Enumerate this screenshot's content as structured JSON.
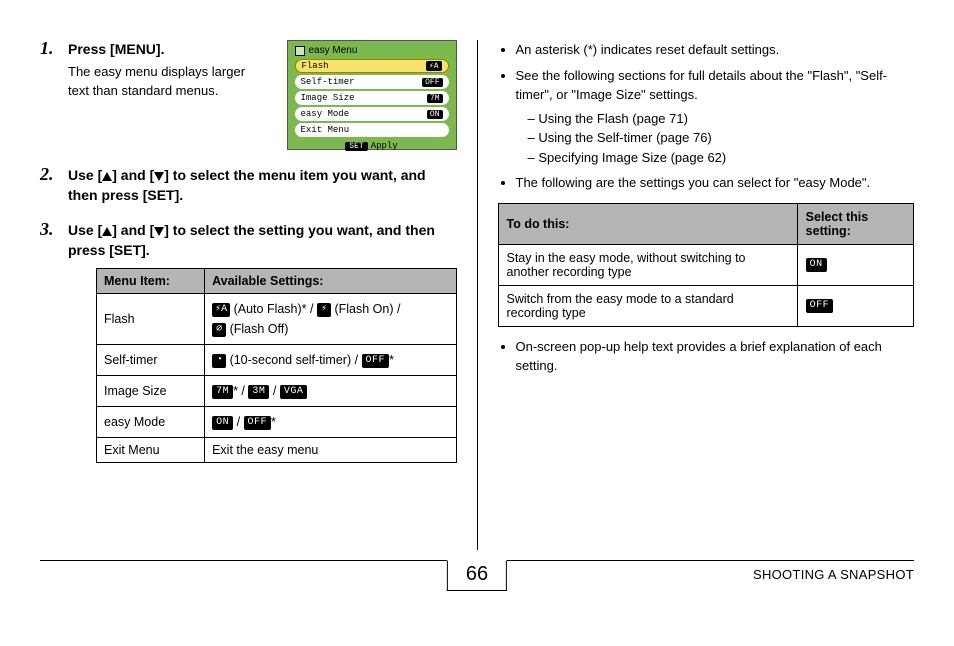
{
  "steps": [
    {
      "num": "1.",
      "head": "Press [MENU].",
      "body": "The easy menu displays larger text than standard menus."
    },
    {
      "num": "2.",
      "head_pre": "Use [",
      "head_mid": "] and [",
      "head_post": "] to select the menu item you want, and then press [SET]."
    },
    {
      "num": "3.",
      "head_pre": "Use [",
      "head_mid": "] and [",
      "head_post": "] to select the setting you want, and then press [SET]."
    }
  ],
  "easyMenu": {
    "title": "easy Menu",
    "rows": [
      {
        "label": "Flash",
        "badge": "⚡A",
        "selected": true
      },
      {
        "label": "Self-timer",
        "badge": "OFF"
      },
      {
        "label": "Image Size",
        "badge": "7M"
      },
      {
        "label": "easy Mode",
        "badge": "ON"
      },
      {
        "label": "Exit Menu",
        "badge": ""
      }
    ],
    "footer_set": "SET",
    "footer_apply": "Apply"
  },
  "table1": {
    "headers": [
      "Menu Item:",
      "Available Settings:"
    ],
    "rows": {
      "flash": {
        "item": "Flash",
        "a": "(Auto Flash)* / ",
        "b": "(Flash On) /",
        "c": "(Flash Off)"
      },
      "selftimer": {
        "item": "Self-timer",
        "a": "(10-second self-timer) / ",
        "off_suffix": "*"
      },
      "imagesize": {
        "item": "Image Size",
        "sep1": "* / ",
        "sep2": " / "
      },
      "easymode": {
        "item": "easy Mode",
        "sep": " / ",
        "off_suffix": "*"
      },
      "exit": {
        "item": "Exit Menu",
        "text": "Exit the easy menu"
      }
    }
  },
  "icons": {
    "auto_flash": "⚡A",
    "flash_on": "⚡",
    "flash_off": "⌀",
    "timer": "◔",
    "off": "OFF",
    "on": "ON",
    "size7m": "7M",
    "size3m": "3M",
    "vga": "VGA"
  },
  "right": {
    "bullet1": "An asterisk (*) indicates reset default settings.",
    "bullet2": "See the following sections for full details about the \"Flash\", \"Self-timer\", or \"Image Size\" settings.",
    "dashes": [
      "Using the Flash (page 71)",
      "Using the Self-timer (page 76)",
      "Specifying Image Size (page 62)"
    ],
    "bullet3": "The following are the settings you can select for \"easy Mode\".",
    "bullet4": "On-screen pop-up help text provides a brief explanation of each setting."
  },
  "table2": {
    "headers": [
      "To do this:",
      "Select this setting:"
    ],
    "rows": [
      {
        "text": "Stay in the easy mode, without switching to another recording type",
        "badge": "ON"
      },
      {
        "text": "Switch from the easy mode to a standard recording type",
        "badge": "OFF"
      }
    ]
  },
  "footer": {
    "page": "66",
    "title": "SHOOTING A SNAPSHOT"
  }
}
